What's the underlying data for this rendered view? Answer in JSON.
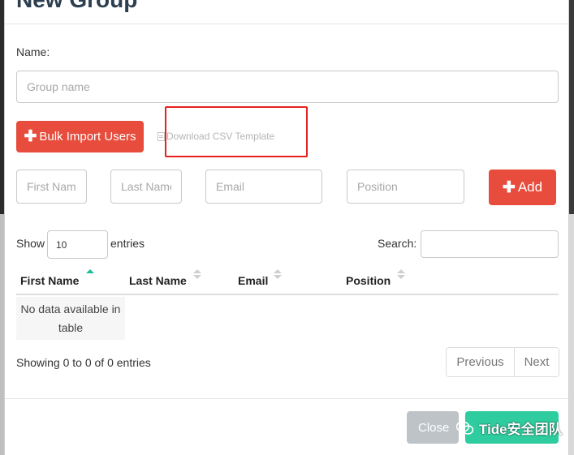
{
  "modal": {
    "title": "New Group",
    "name_label": "Name:",
    "group_name_placeholder": "Group name",
    "bulk_import_label": "Bulk Import Users",
    "csv_template_label": "Download CSV Template",
    "first_name_placeholder": "First Name",
    "last_name_placeholder": "Last Name",
    "email_placeholder": "Email",
    "position_placeholder": "Position",
    "add_label": "Add"
  },
  "table_controls": {
    "show_label": "Show",
    "page_size_value": "10",
    "entries_label": "entries",
    "search_label": "Search:"
  },
  "table": {
    "columns": [
      "First Name",
      "Last Name",
      "Email",
      "Position"
    ],
    "empty_message": "No data available in table",
    "sorted_column": "First Name"
  },
  "pagination": {
    "info": "Showing 0 to 0 of 0 entries",
    "previous": "Previous",
    "next": "Next"
  },
  "footer": {
    "close_label": "Close",
    "watermark": "Tide安全团队"
  },
  "colors": {
    "danger": "#e74c3c",
    "success": "#2ecc9e",
    "sort_active": "#1abc9c",
    "highlight_box": "#e8201d"
  }
}
